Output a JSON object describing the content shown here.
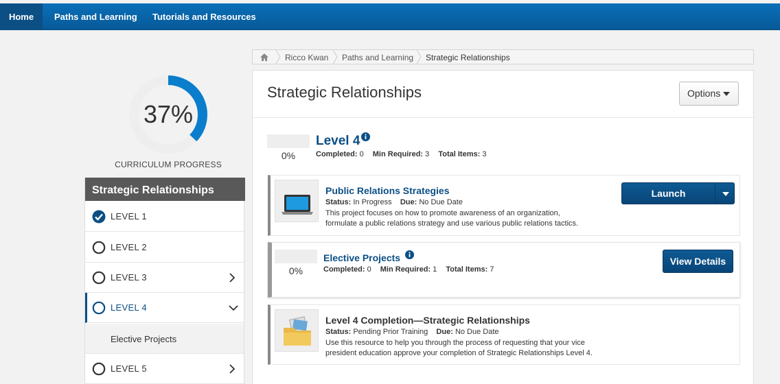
{
  "nav": {
    "home": "Home",
    "paths": "Paths and Learning",
    "tutorials": "Tutorials and Resources"
  },
  "progress": {
    "percent_text": "37%",
    "fraction": 0.37,
    "label": "CURRICULUM PROGRESS",
    "accent": "#0a7dcc"
  },
  "sidebar": {
    "title": "Strategic Relationships",
    "levels": [
      {
        "label": "LEVEL 1",
        "state": "complete"
      },
      {
        "label": "LEVEL 2",
        "state": "open"
      },
      {
        "label": "LEVEL 3",
        "state": "collapsed"
      },
      {
        "label": "LEVEL 4",
        "state": "expanded"
      },
      {
        "label": "LEVEL 5",
        "state": "collapsed"
      }
    ],
    "sub_item": "Elective Projects"
  },
  "breadcrumb": {
    "items": [
      "Ricco Kwan",
      "Paths and Learning",
      "Strategic Relationships"
    ]
  },
  "main": {
    "title": "Strategic Relationships",
    "options_label": "Options",
    "level": {
      "title": "Level 4",
      "percent": "0%",
      "completed_label": "Completed:",
      "completed_value": "0",
      "min_label": "Min Required:",
      "min_value": "3",
      "total_label": "Total Items:",
      "total_value": "3"
    },
    "items": [
      {
        "title": "Public Relations Strategies",
        "status_label": "Status:",
        "status_value": "In Progress",
        "due_label": "Due:",
        "due_value": "No Due Date",
        "desc_line1": "This project focuses on how to promote awareness of an organization,",
        "desc_line2": "formulate a public relations strategy and use various public relations tactics.",
        "button": "Launch",
        "icon": "laptop-icon"
      },
      {
        "title": "Elective Projects",
        "percent": "0%",
        "completed_label": "Completed:",
        "completed_value": "0",
        "min_label": "Min Required:",
        "min_value": "1",
        "total_label": "Total Items:",
        "total_value": "7",
        "button": "View Details"
      },
      {
        "title": "Level 4 Completion—Strategic Relationships",
        "status_label": "Status:",
        "status_value": "Pending Prior Training",
        "due_label": "Due:",
        "due_value": "No Due Date",
        "desc_line1": "Use this resource to help you through the process of requesting that your vice",
        "desc_line2": "president education approve your completion of Strategic Relationships Level 4.",
        "icon": "folder-icon"
      }
    ]
  },
  "colors": {
    "nav_bg": "#075a98",
    "brand_blue": "#0b4f85",
    "sidebar_header": "#595959"
  }
}
